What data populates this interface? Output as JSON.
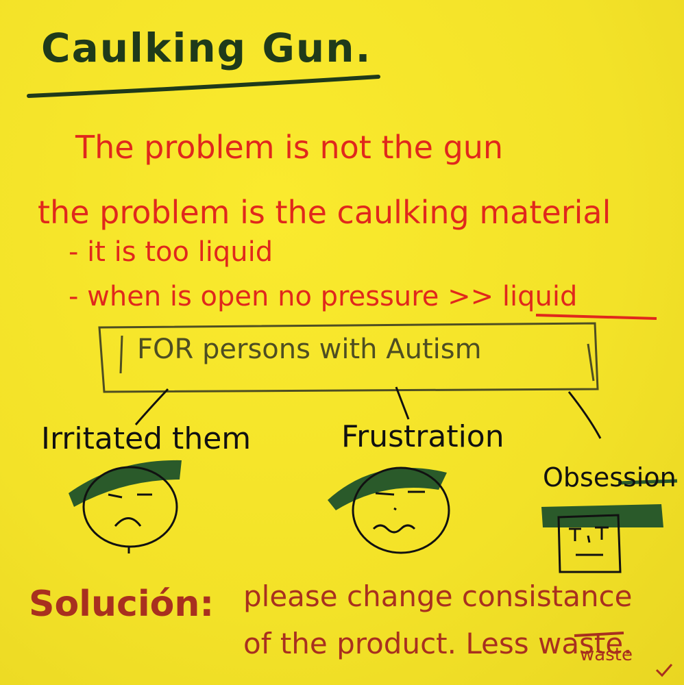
{
  "title": "Caulking Gun.",
  "problem_line1": "The problem is not the gun",
  "problem_line2": "the problem is the caulking material",
  "bullet1": "- it is too liquid",
  "bullet2": "- when is open no pressure >> liquid",
  "box_label": "FOR persons with Autism",
  "emotions": [
    "Irritated them",
    "Frustration",
    "Obsession"
  ],
  "solution_label": "Solución:",
  "solution_line1": "please change consistance",
  "solution_line2": "of the product. Less waste.",
  "waste_note": "waste",
  "colors": {
    "paper": "#f5e62a",
    "red_ink": "#e0281c",
    "dark_ink": "#1f3a1a",
    "green_marker": "#2a5a2a",
    "brown_ink": "#a8301f"
  }
}
